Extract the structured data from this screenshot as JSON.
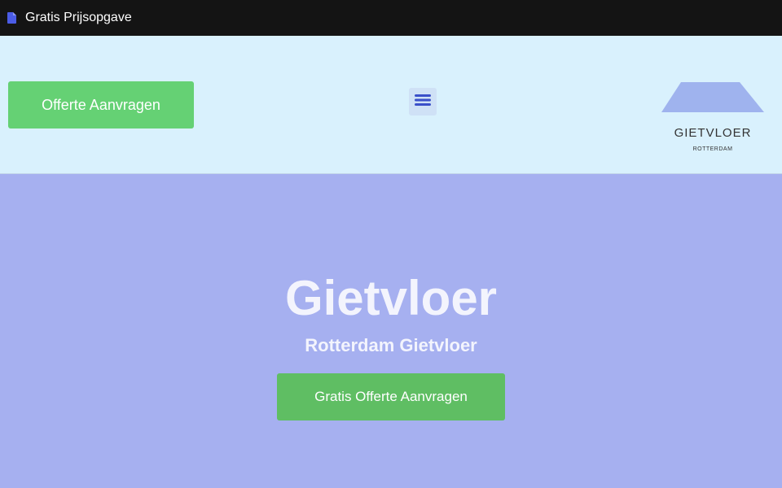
{
  "window": {
    "title": "Gratis Prijsopgave",
    "icon": "document-icon"
  },
  "header": {
    "quote_button_label": "Offerte Aanvragen",
    "menu_icon": "hamburger-menu-icon",
    "logo": {
      "title": "GIETVLOER",
      "subtitle": "ROTTERDAM"
    }
  },
  "hero": {
    "title": "Gietvloer",
    "subtitle": "Rotterdam Gietvloer",
    "cta_label": "Gratis Offerte Aanvragen"
  },
  "colors": {
    "topbar": "#141414",
    "header_bg": "#d9f1fd",
    "hero_bg": "#a6b0f0",
    "button_green": "#65d174",
    "cta_green": "#5fbe63",
    "accent_blue": "#3a4fc9"
  }
}
